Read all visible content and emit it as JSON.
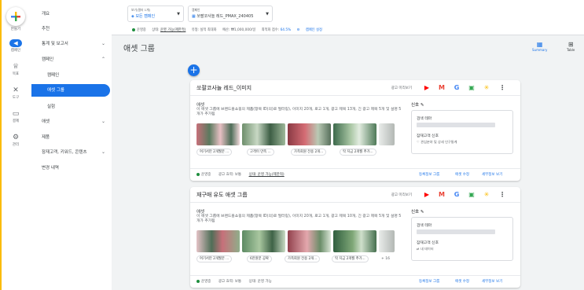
{
  "rail": {
    "create_label": "만들기",
    "items": [
      {
        "label": "캠페인",
        "icon": "megaphone-icon"
      },
      {
        "label": "목표",
        "icon": "trophy-icon"
      },
      {
        "label": "도구",
        "icon": "tools-icon"
      },
      {
        "label": "결제",
        "icon": "credit-card-icon"
      },
      {
        "label": "관리",
        "icon": "gear-icon"
      }
    ]
  },
  "nav": {
    "items": [
      {
        "label": "개요"
      },
      {
        "label": "추천"
      },
      {
        "label": "통계 및 보고서"
      },
      {
        "label": "캠페인"
      },
      {
        "label": "캠페인"
      },
      {
        "label": "애셋 그룹"
      },
      {
        "label": "실험"
      },
      {
        "label": "애셋"
      },
      {
        "label": "제품"
      },
      {
        "label": "잠재고객, 키워드, 콘텐츠"
      },
      {
        "label": "변경 내역"
      }
    ]
  },
  "topbar": {
    "view_label": "보기(필터 1개)",
    "view_value": "모든 캠페인",
    "campaign_label": "캠페인",
    "campaign_value": "쏘팔코사놀 레드_PMAX_240405",
    "status": {
      "state": "운영중",
      "status_label": "상태:",
      "status_value": "운영 가능(제한적)",
      "type": "유형: 실적 최대화",
      "budget": "예산: ₩1,000,000/일",
      "score_label": "최적화 점수:",
      "score_value": "64.5%",
      "settings": "캠페인 설정"
    }
  },
  "page": {
    "title": "애셋 그룹",
    "summary_label": "Summary",
    "table_label": "Table"
  },
  "cards": [
    {
      "title": "쏘팔코사놀 레드_이미지",
      "preview": "광고 미리보기",
      "asset_label": "애셋",
      "asset_desc": "이 애셋 그룹에 브랜드홈쇼핑의 제품(항목 ID(의)로 필터링), 이미지 20개, 로고 1개, 광고 제목 13개, 긴 광고 제목 5개 및 설명 5개가 추가됨",
      "chips": [
        "여기서만 2개월분 ...",
        "고객이 만족 ...",
        "가족회원 전용 2개...",
        "딱 지금 2개월 추가..."
      ],
      "more": "",
      "signals_label": "신호",
      "search_theme": "검색 테마",
      "audience": "잠재고객 신호",
      "audience_desc": "관심분야 및 상세 인구통계",
      "state": "운영중",
      "strength": "광고 효력: 보통",
      "status": "상태: 운영 가능(제한적)",
      "links": [
        "등록정보 그룹",
        "애셋 수정",
        "세부정보 보기"
      ]
    },
    {
      "title": "재구매 유도 애셋 그룹",
      "preview": "광고 미리보기",
      "asset_label": "애셋",
      "asset_desc": "이 애셋 그룹에 브랜드홈쇼핑의 제품(항목 ID(의)로 필터링), 이미지 20개, 로고 1개, 광고 제목 10개, 긴 광고 제목 5개 및 설명 5개가 추가됨",
      "chips": [
        "여기서만 2개월분 ...",
        "6만원분 공짜",
        "가족회원 전용 2개...",
        "딱 지금 2개월 추가..."
      ],
      "more": "+ 16",
      "signals_label": "신호",
      "search_theme": "검색 테마",
      "audience": "잠재고객 신호",
      "audience_desc": "내 데이터",
      "state": "운영중",
      "strength": "광고 효력: 보통",
      "status": "상태: 운영 가능",
      "links": [
        "등록정보 그룹",
        "애셋 수정",
        "세부정보 보기"
      ]
    }
  ]
}
